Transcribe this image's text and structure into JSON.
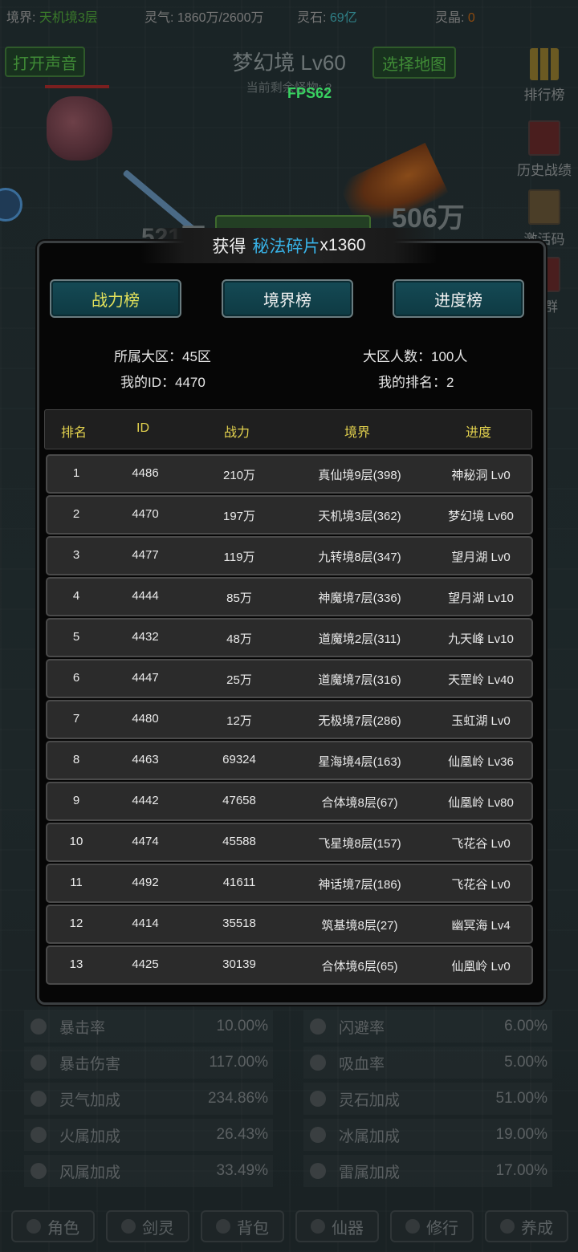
{
  "status": {
    "realm_label": "境界: ",
    "realm_value": "天机境3层",
    "lingqi_label": "灵气: ",
    "lingqi_value": "1860万/2600万",
    "lingshi_label": "灵石: ",
    "lingshi_value": "69亿",
    "lingjing_label": "灵晶: ",
    "lingjing_value": "0"
  },
  "top": {
    "sound_button": "打开声音",
    "map_title": "梦幻境 Lv60",
    "map_sub": "当前剩余怪物: 2",
    "choose_map_button": "选择地图",
    "fps": "FPS62"
  },
  "side_menu": [
    "排行榜",
    "历史战绩",
    "激活码",
    "加群"
  ],
  "floating_damage": [
    "506万",
    "521万"
  ],
  "stats_bg": [
    {
      "name": "暴击率",
      "value": "10.00%"
    },
    {
      "name": "闪避率",
      "value": "6.00%"
    },
    {
      "name": "暴击伤害",
      "value": "117.00%"
    },
    {
      "name": "吸血率",
      "value": "5.00%"
    },
    {
      "name": "灵气加成",
      "value": "234.86%"
    },
    {
      "name": "灵石加成",
      "value": "51.00%"
    },
    {
      "name": "火属加成",
      "value": "26.43%"
    },
    {
      "name": "冰属加成",
      "value": "19.00%"
    },
    {
      "name": "风属加成",
      "value": "33.49%"
    },
    {
      "name": "雷属加成",
      "value": "17.00%"
    }
  ],
  "bottom_tabs": [
    "角色",
    "剑灵",
    "背包",
    "仙器",
    "修行",
    "养成"
  ],
  "toast": {
    "prefix": "获得",
    "item": "秘法碎片",
    "count": "x1360"
  },
  "ranking": {
    "tabs": [
      "战力榜",
      "境界榜",
      "进度榜"
    ],
    "server_label": "所属大区：45区",
    "population_label": "大区人数：100人",
    "my_id_label": "我的ID：4470",
    "my_rank_label": "我的排名：2",
    "headers": [
      "排名",
      "ID",
      "战力",
      "境界",
      "进度"
    ],
    "rows": [
      [
        "1",
        "4486",
        "210万",
        "真仙境9层(398)",
        "神秘洞 Lv0"
      ],
      [
        "2",
        "4470",
        "197万",
        "天机境3层(362)",
        "梦幻境 Lv60"
      ],
      [
        "3",
        "4477",
        "119万",
        "九转境8层(347)",
        "望月湖 Lv0"
      ],
      [
        "4",
        "4444",
        "85万",
        "神魔境7层(336)",
        "望月湖 Lv10"
      ],
      [
        "5",
        "4432",
        "48万",
        "道魔境2层(311)",
        "九天峰 Lv10"
      ],
      [
        "6",
        "4447",
        "25万",
        "道魔境7层(316)",
        "天罡岭 Lv40"
      ],
      [
        "7",
        "4480",
        "12万",
        "无极境7层(286)",
        "玉虹湖 Lv0"
      ],
      [
        "8",
        "4463",
        "69324",
        "星海境4层(163)",
        "仙凰岭 Lv36"
      ],
      [
        "9",
        "4442",
        "47658",
        "合体境8层(67)",
        "仙凰岭 Lv80"
      ],
      [
        "10",
        "4474",
        "45588",
        "飞星境8层(157)",
        "飞花谷 Lv0"
      ],
      [
        "11",
        "4492",
        "41611",
        "神话境7层(186)",
        "飞花谷 Lv0"
      ],
      [
        "12",
        "4414",
        "35518",
        "筑基境8层(27)",
        "幽冥海 Lv4"
      ],
      [
        "13",
        "4425",
        "30139",
        "合体境6层(65)",
        "仙凰岭 Lv0"
      ]
    ]
  }
}
